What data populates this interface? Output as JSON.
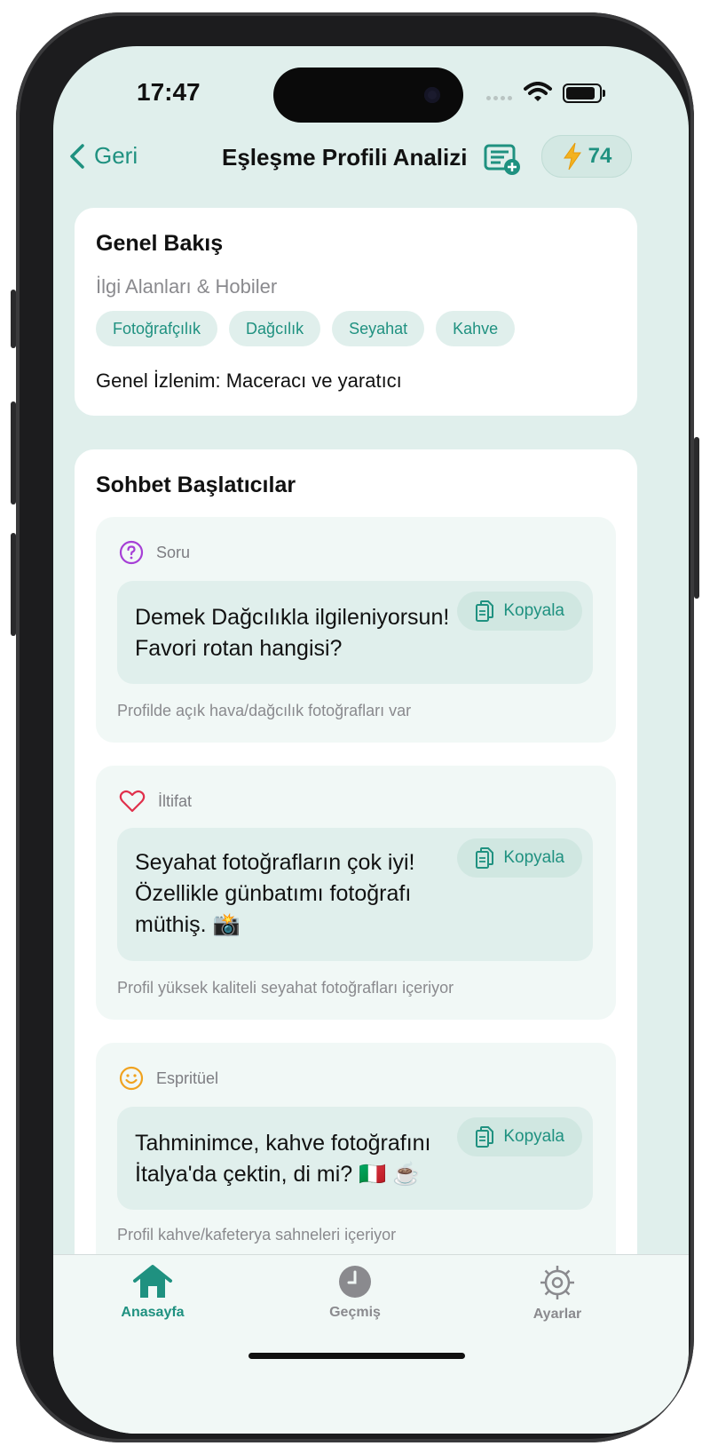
{
  "status": {
    "time": "17:47"
  },
  "nav": {
    "back_label": "Geri",
    "title": "Eşleşme Profili Analizi",
    "credits": "74"
  },
  "overview": {
    "title": "Genel Bakış",
    "subtitle": "İlgi Alanları & Hobiler",
    "tags": [
      "Fotoğrafçılık",
      "Dağcılık",
      "Seyahat",
      "Kahve"
    ],
    "impression": "Genel İzlenim: Maceracı ve yaratıcı"
  },
  "starters": {
    "title": "Sohbet Başlatıcılar",
    "copy_label": "Kopyala",
    "items": [
      {
        "type": "Soru",
        "icon": "question-circle-icon",
        "lines": [
          "Demek Dağcılıkla ilgileniyorsun!",
          "Favori rotan hangisi?"
        ],
        "reason": "Profilde açık hava/dağcılık fotoğrafları var"
      },
      {
        "type": "İltifat",
        "icon": "heart-icon",
        "lines": [
          "Seyahat fotoğrafların çok iyi!",
          "Özellikle günbatımı fotoğrafı",
          "müthiş. 📸"
        ],
        "reason": "Profil yüksek kaliteli seyahat fotoğrafları içeriyor"
      },
      {
        "type": "Espritüel",
        "icon": "smile-icon",
        "lines": [
          "Tahminimce, kahve fotoğrafını",
          "İtalya'da çektin, di mi? 🇮🇹 ☕"
        ],
        "reason": "Profil kahve/kafeterya sahneleri içeriyor"
      }
    ]
  },
  "tabs": [
    {
      "label": "Anasayfa",
      "icon": "home-icon",
      "active": true
    },
    {
      "label": "Geçmiş",
      "icon": "clock-icon",
      "active": false
    },
    {
      "label": "Ayarlar",
      "icon": "gear-icon",
      "active": false
    }
  ],
  "colors": {
    "accent": "#1f9180",
    "background": "#e0efec",
    "question": "#a63fd6",
    "heart": "#e0304b",
    "smile": "#f0a21f"
  }
}
